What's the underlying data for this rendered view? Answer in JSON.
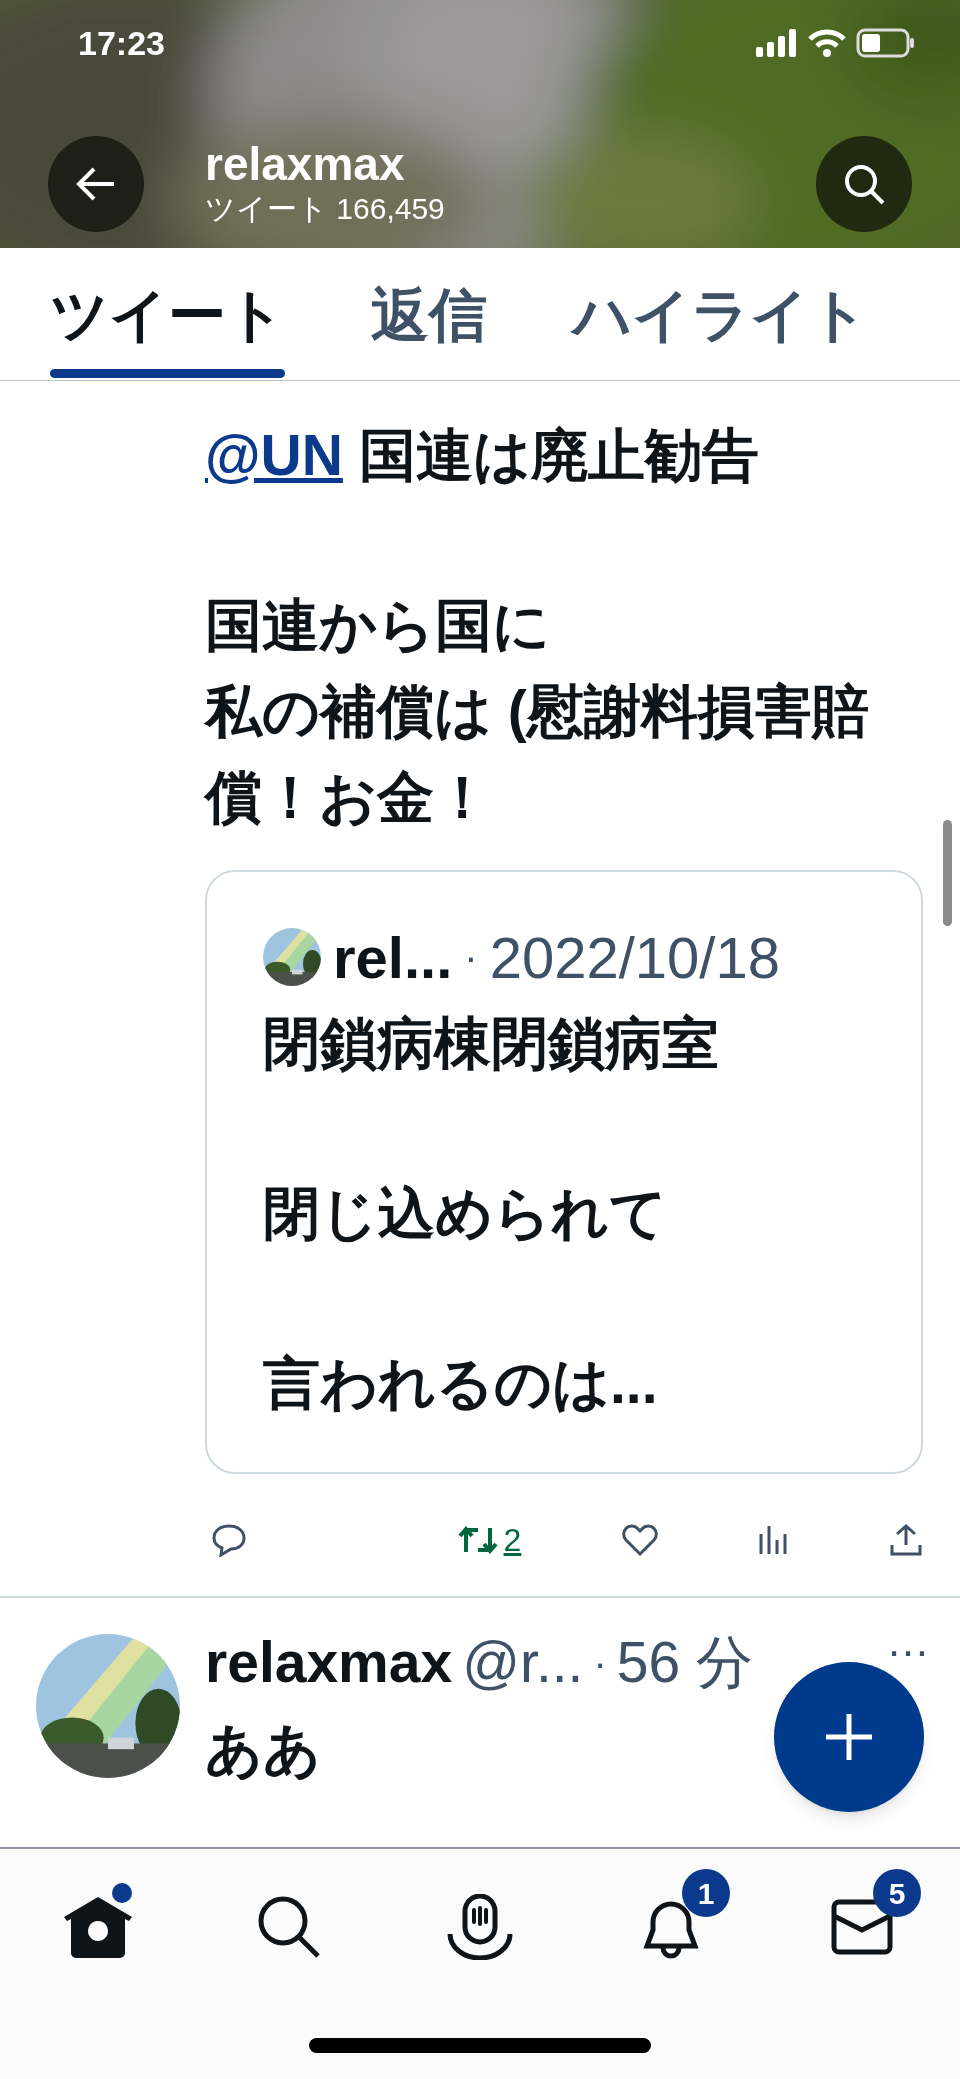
{
  "status_bar": {
    "time": "17:23"
  },
  "header": {
    "title": "relaxmax",
    "subtitle": "ツイート 166,459"
  },
  "tabs": [
    {
      "label": "ツイート",
      "selected": true
    },
    {
      "label": "返信",
      "selected": false
    },
    {
      "label": "ハイライト",
      "selected": false
    }
  ],
  "tweets": [
    {
      "kind": "continued",
      "first_line": {
        "mention": "@UN",
        "text": "国連は廃止勧告"
      },
      "paragraphs": [
        [
          "国連から国に",
          "私の補償は (慰謝料損害賠償！お金！"
        ]
      ],
      "quote": {
        "name": "rel...",
        "separator": "·",
        "date": "2022/10/18",
        "paragraphs": [
          [
            "閉鎖病棟閉鎖病室"
          ],
          [
            "閉じ込められて"
          ],
          [
            "言われるのは..."
          ]
        ]
      },
      "actions": {
        "retweets": "2",
        "retweeted": true,
        "liked": false
      }
    },
    {
      "kind": "full",
      "name": "relaxmax",
      "handle": "@r...",
      "separator": "·",
      "time": "56 分",
      "more": "…",
      "lines": [
        "ああ"
      ]
    }
  ],
  "nav": [
    {
      "kind": "home",
      "selected": true,
      "dot": true
    },
    {
      "kind": "search",
      "selected": false
    },
    {
      "kind": "spaces",
      "selected": false
    },
    {
      "kind": "notifications",
      "selected": false,
      "badge": "1"
    },
    {
      "kind": "messages",
      "selected": false,
      "badge": "5"
    }
  ]
}
